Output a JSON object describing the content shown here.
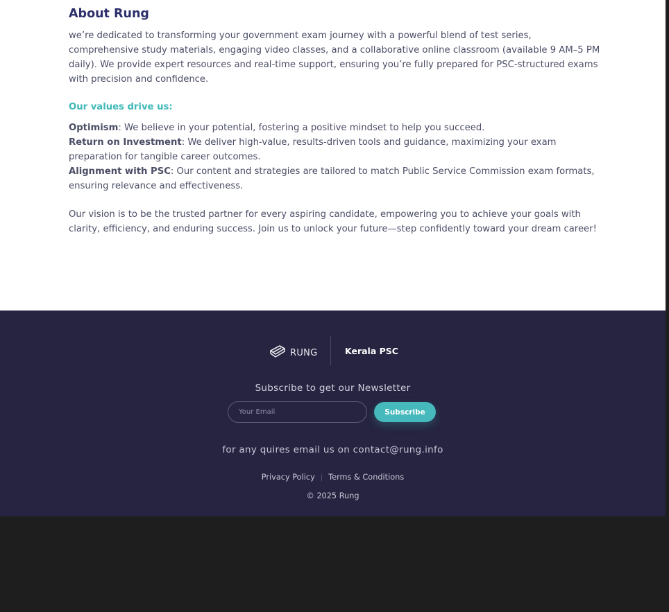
{
  "about": {
    "title": "About Rung",
    "intro": "we’re dedicated to transforming your government exam journey with a powerful blend of test series, comprehensive study materials, engaging video classes, and a collaborative online classroom (available 9 AM–5 PM daily). We provide expert resources and real-time support, ensuring you’re fully prepared for PSC-structured exams with precision and confidence.",
    "values_heading": "Our values drive us:",
    "values": [
      {
        "name": "Optimism",
        "text": ": We believe in your potential, fostering a positive mindset to help you succeed."
      },
      {
        "name": "Return on Investment",
        "text": ": We deliver high-value, results-driven tools and guidance, maximizing your exam preparation for tangible career outcomes."
      },
      {
        "name": "Alignment with PSC",
        "text": ": Our content and strategies are tailored to match Public Service Commission exam formats, ensuring relevance and effectiveness."
      }
    ],
    "vision": "Our vision is to be the trusted partner for every aspiring candidate, empowering you to achieve your goals with clarity, efficiency, and enduring success. Join us to unlock your future—step confidently toward your dream career!"
  },
  "footer": {
    "logo_text": "RUNG",
    "logo_icon": "rung-logo-icon",
    "exam_label": "Kerala PSC",
    "newsletter_title": "Subscribe to get our Newsletter",
    "email_placeholder": "Your Email",
    "email_value": "",
    "subscribe_label": "Subscribe",
    "contact_text": "for any quires email us on contact@rung.info",
    "links": [
      "Privacy Policy",
      "Terms & Conditions"
    ],
    "link_separator": "|",
    "copyright": "© 2025 Rung"
  },
  "colors": {
    "accent": "#45b9bb",
    "heading": "#2c2f6a",
    "footer_bg": "#262440",
    "outer_bg": "#1e1e1e"
  }
}
